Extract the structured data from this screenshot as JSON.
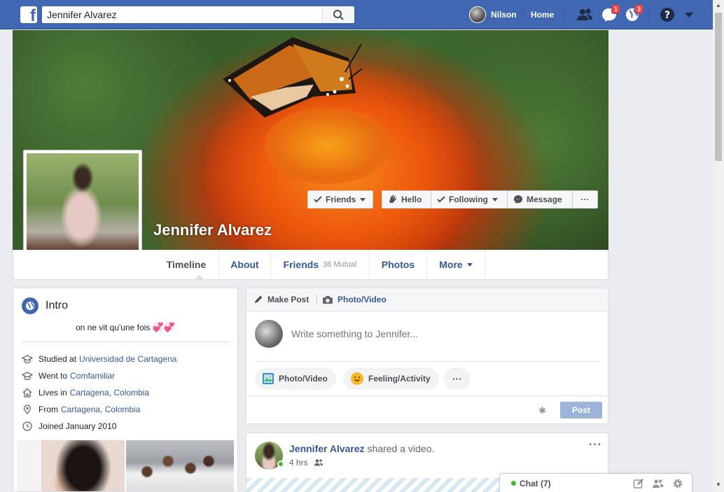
{
  "topbar": {
    "search_value": "Jennifer Alvarez",
    "user_name": "Nilson",
    "home_label": "Home",
    "messages_count": "1",
    "notifications_count": "3",
    "brand_color": "#4267b2"
  },
  "profile": {
    "name": "Jennifer Alvarez",
    "buttons": {
      "friends": "Friends",
      "hello": "Hello",
      "following": "Following",
      "message": "Message",
      "more": "···"
    }
  },
  "tabs": {
    "timeline": "Timeline",
    "about": "About",
    "friends": "Friends",
    "mutual": "36 Mutual",
    "photos": "Photos",
    "more": "More"
  },
  "intro": {
    "title": "Intro",
    "bio": "on ne vit qu'une fois",
    "bio_emoji": "💞💞",
    "studied_prefix": "Studied at",
    "studied_link": "Universidad de Cartagena",
    "went_prefix": "Went to",
    "went_link": "Comfamiliar",
    "lives_prefix": "Lives in",
    "lives_link": "Cartagena, Colombia",
    "from_prefix": "From",
    "from_link": "Cartagena, Colombia",
    "joined": "Joined January 2010"
  },
  "composer": {
    "tab_make_post": "Make Post",
    "tab_photo_video": "Photo/Video",
    "placeholder": "Write something to Jennifer...",
    "photo_video_btn": "Photo/Video",
    "feeling_btn": "Feeling/Activity",
    "more_btn": "···",
    "post_btn": "Post"
  },
  "post": {
    "author": "Jennifer Alvarez",
    "action": "shared a video.",
    "time": "4 hrs",
    "more": "···"
  },
  "chat": {
    "label": "Chat (7)"
  }
}
